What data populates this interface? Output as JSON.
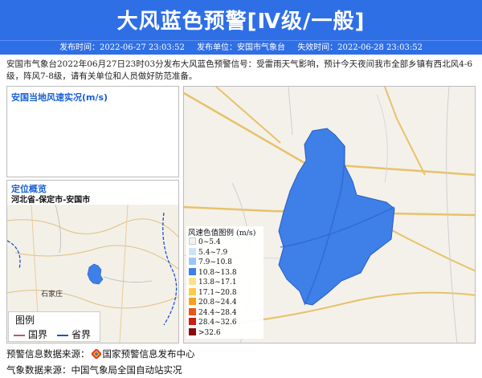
{
  "header": {
    "title": "大风蓝色预警[Ⅳ级/一般]",
    "issue_time": "发布时间：2022-06-27 23:03:52",
    "issuer": "发布单位：安国市气象台",
    "expire_time": "失效时间：2022-06-28 23:03:52"
  },
  "description": "安国市气象台2022年06月27日23时03分发布大风蓝色预警信号：受雷雨天气影响，预计今天夜间我市全部乡镇有西北风4-6级，阵风7-8级，请有关单位和人员做好防范准备。",
  "wind_panel": {
    "title": "安国当地风速实况(m/s)"
  },
  "location_panel": {
    "title": "定位概览",
    "subtitle": "河北省-保定市-安国市",
    "city_label": "石家庄"
  },
  "mini_legend": {
    "title": "图例",
    "national_border": "国界",
    "provincial_border": "省界",
    "colors": {
      "national": "#c0556a",
      "provincial": "#2050c8"
    }
  },
  "wind_legend": {
    "title": "风速色值图例 (m/s)",
    "items": [
      {
        "label": "0~5.4",
        "color": "#f2f2f2"
      },
      {
        "label": "5.4~7.9",
        "color": "#cfe3f7"
      },
      {
        "label": "7.9~10.8",
        "color": "#9cc7f2"
      },
      {
        "label": "10.8~13.8",
        "color": "#3e7fe8"
      },
      {
        "label": "13.8~17.1",
        "color": "#ffe08a"
      },
      {
        "label": "17.1~20.8",
        "color": "#ffc94a"
      },
      {
        "label": "20.8~24.4",
        "color": "#f5a11c"
      },
      {
        "label": "24.4~28.4",
        "color": "#e8561a"
      },
      {
        "label": "28.4~32.6",
        "color": "#cc1e14"
      },
      {
        "label": ">32.6",
        "color": "#8a0b0b"
      }
    ]
  },
  "footer": {
    "warning_source_label": "预警信息数据来源：",
    "warning_source": "国家预警信息发布中心",
    "weather_source": "气象数据来源：中国气象局全国自动站实况"
  },
  "colors": {
    "accent": "#2f6fe6",
    "warning_region": "#3e7fe8"
  }
}
